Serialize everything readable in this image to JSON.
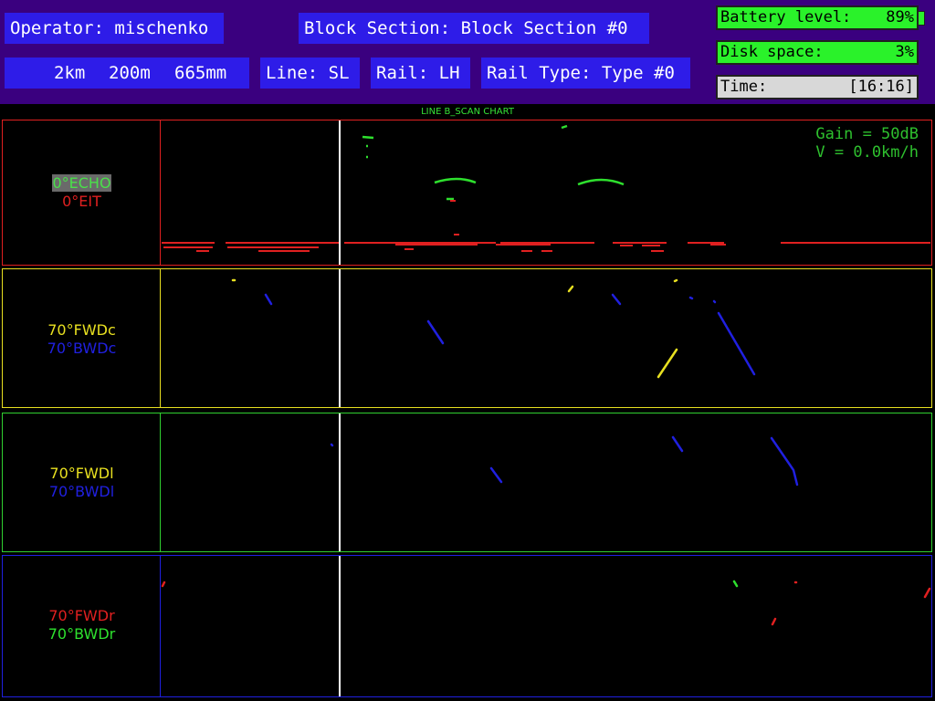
{
  "header": {
    "operator": "Operator: mischenko",
    "block_section": "Block Section: Block Section #0",
    "km": "2km",
    "m": "200m",
    "mm": "665mm",
    "line": "Line: SL",
    "rail": "Rail: LH",
    "rail_type": "Rail Type: Type #0"
  },
  "status": {
    "battery_label": "Battery level:",
    "battery_value": "89%",
    "disk_label": "Disk space:",
    "disk_value": "3%",
    "time_label": "Time:",
    "time_value": "[16:16]"
  },
  "chart": {
    "title": "LINE B_SCAN CHART",
    "gain": "Gain = 50dB",
    "speed": "V = 0.0km/h"
  },
  "channels": {
    "echo": "0°ECHO",
    "eit": "0°EIT",
    "fwdc": "70°FWDc",
    "bwdc": "70°BWDc",
    "fwdl": "70°FWDl",
    "bwdl": "70°BWDl",
    "fwdr": "70°FWDr",
    "bwdr": "70°BWDr"
  },
  "colors": {
    "background": "#3a007f",
    "header_box": "#2e1ce8",
    "status_green": "#2af22a",
    "panel1_border": "#e02020",
    "panel2_border": "#e8e020",
    "panel3_border": "#30d030",
    "panel4_border": "#2020e0",
    "cursor": "#ffffff"
  }
}
